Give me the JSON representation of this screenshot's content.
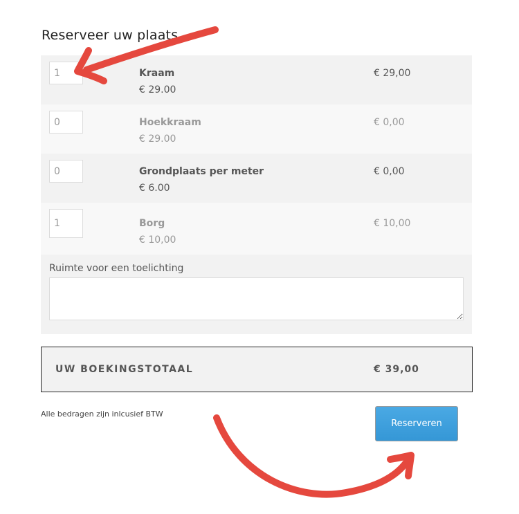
{
  "page": {
    "title": "Reserveer uw plaats"
  },
  "items": [
    {
      "quantity": "1",
      "name": "Kraam",
      "unit_price": "€ 29.00",
      "line_total": "€ 29,00"
    },
    {
      "quantity": "0",
      "name": "Hoekkraam",
      "unit_price": "€ 29.00",
      "line_total": "€ 0,00"
    },
    {
      "quantity": "0",
      "name": "Grondplaats per meter",
      "unit_price": "€ 6.00",
      "line_total": "€ 0,00"
    },
    {
      "quantity": "1",
      "name": "Borg",
      "unit_price": "€ 10,00",
      "line_total": "€ 10,00"
    }
  ],
  "notes": {
    "label": "Ruimte voor een toelichting",
    "value": ""
  },
  "summary": {
    "label": "UW BOEKINGSTOTAAL",
    "total": "€ 39,00"
  },
  "footer": {
    "vat_note": "Alle bedragen zijn inlcusief BTW",
    "reserve_label": "Reserveren"
  },
  "colors": {
    "accent": "#3b9fdd",
    "annotation_arrow": "#e5483e"
  }
}
